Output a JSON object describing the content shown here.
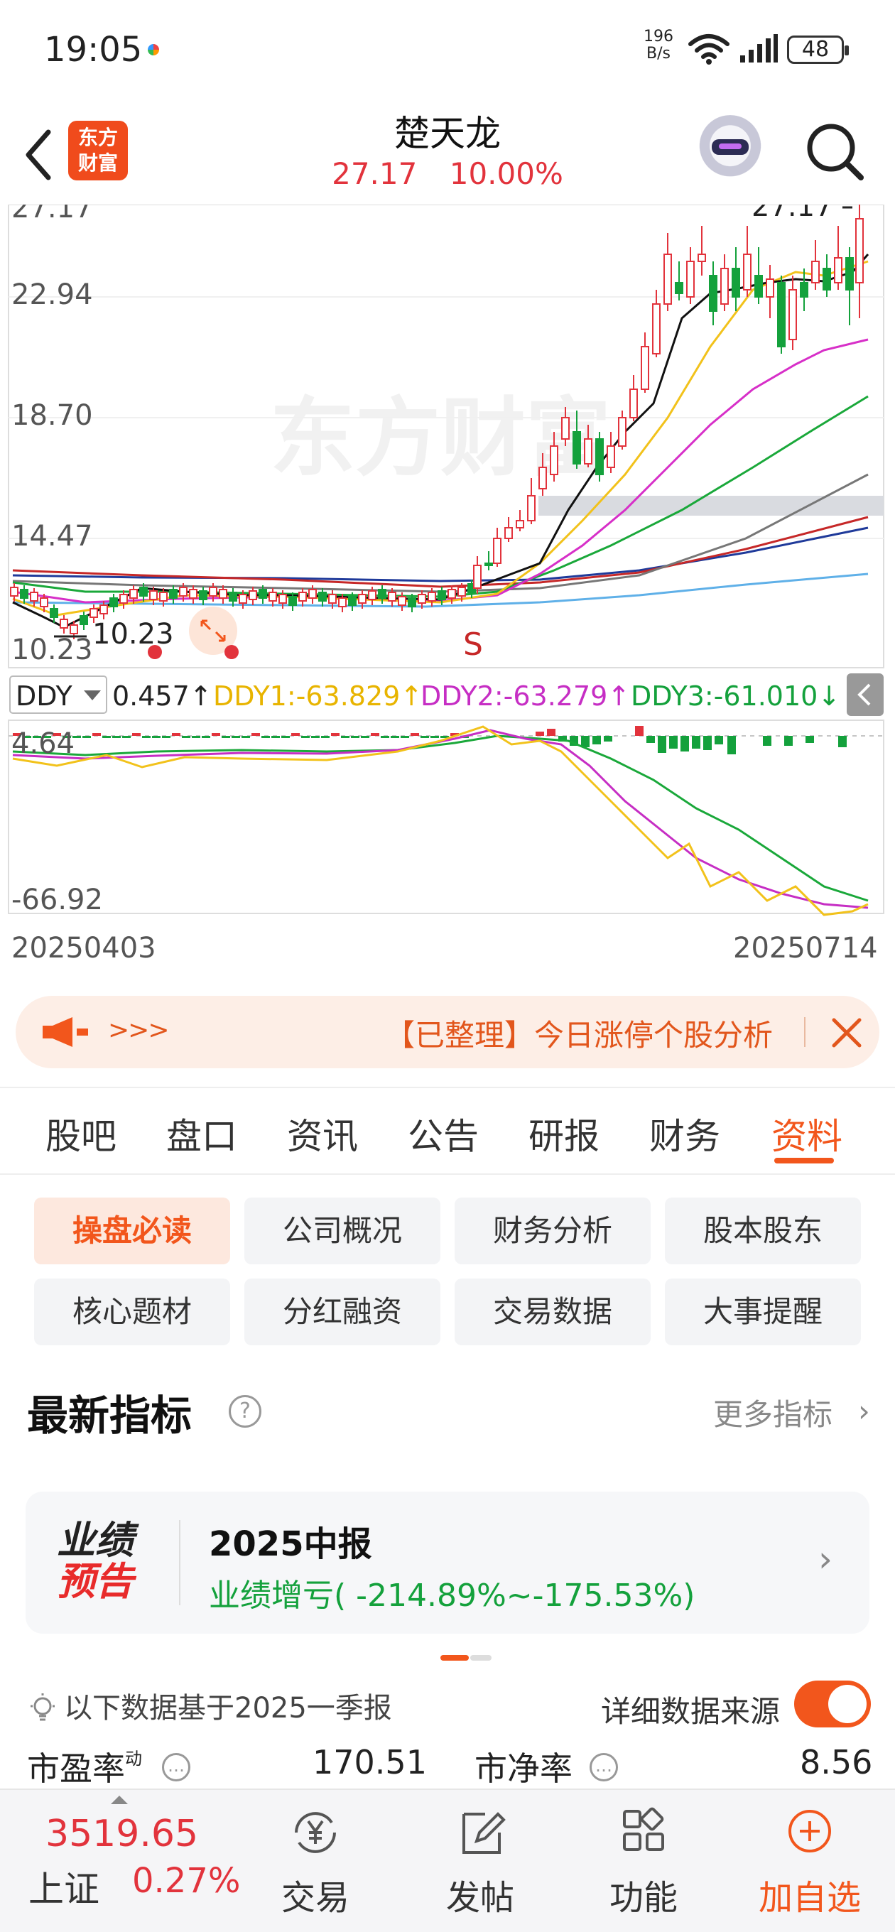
{
  "status_bar": {
    "time": "19:05",
    "net_speed_value": "196",
    "net_speed_unit": "B/s",
    "battery": "48"
  },
  "header": {
    "logo_line1": "东方",
    "logo_line2": "财富",
    "stock_name": "楚天龙",
    "price": "27.17",
    "change_pct": "10.00%"
  },
  "chart": {
    "watermark": "东方财富",
    "price_ticks": [
      "27.17",
      "22.94",
      "18.70",
      "14.47",
      "10.23"
    ],
    "high_marker": "27.17",
    "low_marker": "10.23",
    "signal_label": "S",
    "indicator_name": "DDY",
    "ddy_value": "0.457↑",
    "ddy1": "DDY1:-63.829↑",
    "ddy2": "DDY2:-63.279↑",
    "ddy3": "DDY3:-61.010↓",
    "ind_ticks": [
      "4.64",
      "-66.92"
    ],
    "date_start": "20250403",
    "date_end": "20250714",
    "colors": {
      "up": "#e2333c",
      "down": "#14a13c",
      "ma_black": "#111111",
      "ma_yellow": "#f2c21b",
      "ma_magenta": "#d72fc8",
      "ma_green": "#1aa83a",
      "ma_gray": "#777777",
      "ma_red": "#c62828",
      "ma_navy": "#1f3a9a",
      "ma_skyblue": "#5fb0e8"
    }
  },
  "notice": {
    "arrows": ">>>",
    "text": "【已整理】今日涨停个股分析"
  },
  "tabs": [
    "股吧",
    "盘口",
    "资讯",
    "公告",
    "研报",
    "财务",
    "资料"
  ],
  "active_tab": "资料",
  "sub_buttons": [
    "操盘必读",
    "公司概况",
    "财务分析",
    "股本股东",
    "核心题材",
    "分红融资",
    "交易数据",
    "大事提醒"
  ],
  "section": {
    "title": "最新指标",
    "more": "更多指标",
    "card": {
      "badge_line1": "业绩",
      "badge_line2": "预告",
      "title": "2025中报",
      "value": "业绩增亏( -214.89%~-175.53%)"
    },
    "basis": "以下数据基于2025一季报",
    "source_label": "详细数据来源",
    "metrics": [
      {
        "label": "市盈率",
        "sup": "动",
        "value": "170.51"
      },
      {
        "label": "市净率",
        "value": "8.56"
      }
    ]
  },
  "bottom_nav": {
    "index_value": "3519.65",
    "index_name": "上证",
    "index_pct": "0.27%",
    "items": [
      "交易",
      "发帖",
      "功能",
      "加自选"
    ]
  }
}
